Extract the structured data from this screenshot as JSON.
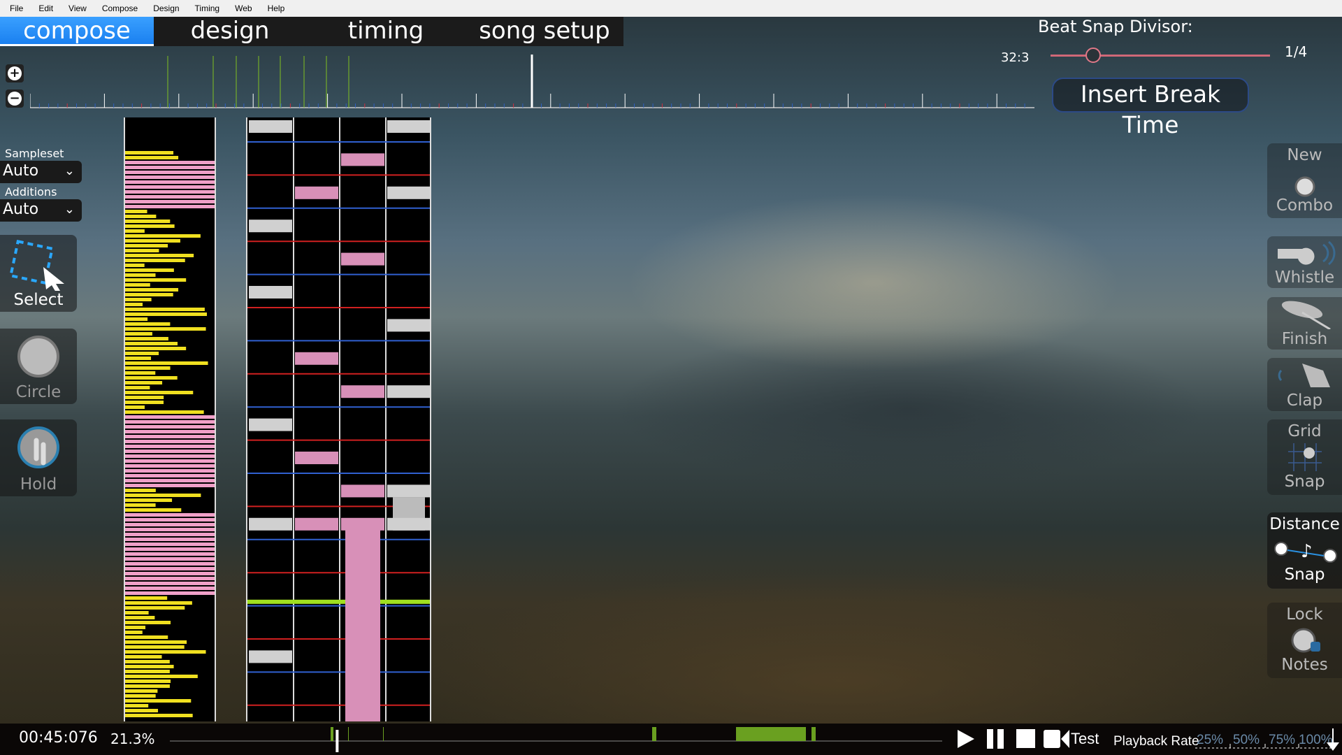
{
  "menu": [
    "File",
    "Edit",
    "View",
    "Compose",
    "Design",
    "Timing",
    "Web",
    "Help"
  ],
  "tabs": [
    {
      "label": "compose",
      "active": true
    },
    {
      "label": "design"
    },
    {
      "label": "timing"
    },
    {
      "label": "song setup"
    }
  ],
  "beat_snap": {
    "label": "Beat Snap Divisor:",
    "position": "32:3",
    "value": "1/4",
    "level": 0.2
  },
  "insert_break": "Insert Break Time",
  "left": {
    "sampleset_label": "Sampleset",
    "sampleset_value": "Auto",
    "additions_label": "Additions",
    "additions_value": "Auto",
    "tools": [
      "Select",
      "Circle",
      "Hold"
    ]
  },
  "right": {
    "new_combo": [
      "New",
      "Combo"
    ],
    "whistle": "Whistle",
    "finish": "Finish",
    "clap": "Clap",
    "grid_snap": [
      "Grid",
      "Snap"
    ],
    "distance_snap": [
      "Distance",
      "Snap"
    ],
    "lock_notes": [
      "Lock",
      "Notes"
    ]
  },
  "bottom": {
    "time": "00:45:076",
    "percent": "21.3%",
    "progress": 0.213,
    "test": "Test",
    "playback_rate": "Playback Rate",
    "rates": [
      "25%",
      "50%",
      "75%",
      "100%"
    ]
  },
  "colors": {
    "accent": "#1e8fff",
    "note_white": "#d0d0d0",
    "note_pink": "#d890b8",
    "bar_yellow": "#f0e020",
    "bar_pink": "#f0a0c8",
    "kiai_green": "#a0e020"
  }
}
